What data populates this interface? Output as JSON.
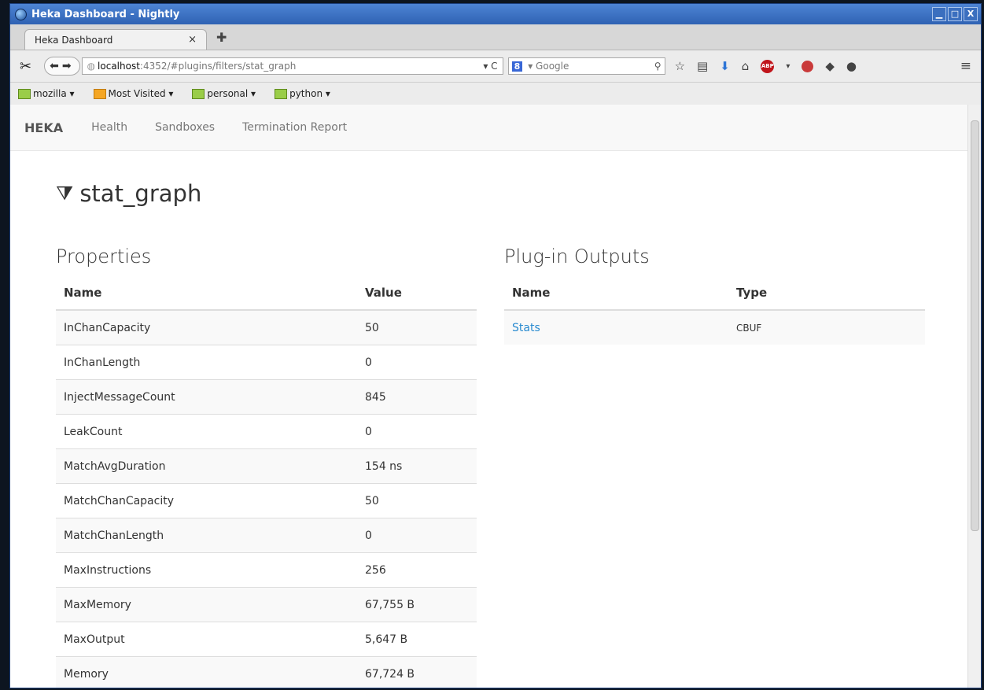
{
  "window": {
    "title": "Heka Dashboard - Nightly",
    "min": "▁",
    "max": "□",
    "close": "X"
  },
  "tab": {
    "label": "Heka Dashboard",
    "close": "×",
    "new": "✚"
  },
  "navbar": {
    "host": "localhost",
    "path": ":4352/#plugins/filters/stat_graph",
    "reload": "▾ C",
    "search_engine": "8",
    "search_placeholder": "▾ Google"
  },
  "bookmarks": [
    {
      "label": "mozilla ▾",
      "folder": "green"
    },
    {
      "label": "Most Visited ▾",
      "folder": "orange"
    },
    {
      "label": "personal ▾",
      "folder": "green"
    },
    {
      "label": "python ▾",
      "folder": "green"
    }
  ],
  "app": {
    "brand": "HEKA",
    "nav": [
      "Health",
      "Sandboxes",
      "Termination Report"
    ],
    "title": "stat_graph"
  },
  "properties": {
    "heading": "Properties",
    "columns": [
      "Name",
      "Value"
    ],
    "rows": [
      [
        "InChanCapacity",
        "50"
      ],
      [
        "InChanLength",
        "0"
      ],
      [
        "InjectMessageCount",
        "845"
      ],
      [
        "LeakCount",
        "0"
      ],
      [
        "MatchAvgDuration",
        "154 ns"
      ],
      [
        "MatchChanCapacity",
        "50"
      ],
      [
        "MatchChanLength",
        "0"
      ],
      [
        "MaxInstructions",
        "256"
      ],
      [
        "MaxMemory",
        "67,755 B"
      ],
      [
        "MaxOutput",
        "5,647 B"
      ],
      [
        "Memory",
        "67,724 B"
      ]
    ]
  },
  "outputs": {
    "heading": "Plug-in Outputs",
    "columns": [
      "Name",
      "Type"
    ],
    "rows": [
      [
        "Stats",
        "CBUF"
      ]
    ]
  },
  "colors": {
    "link": "#2a8bd0",
    "titlebar": "#3b6fbf"
  }
}
